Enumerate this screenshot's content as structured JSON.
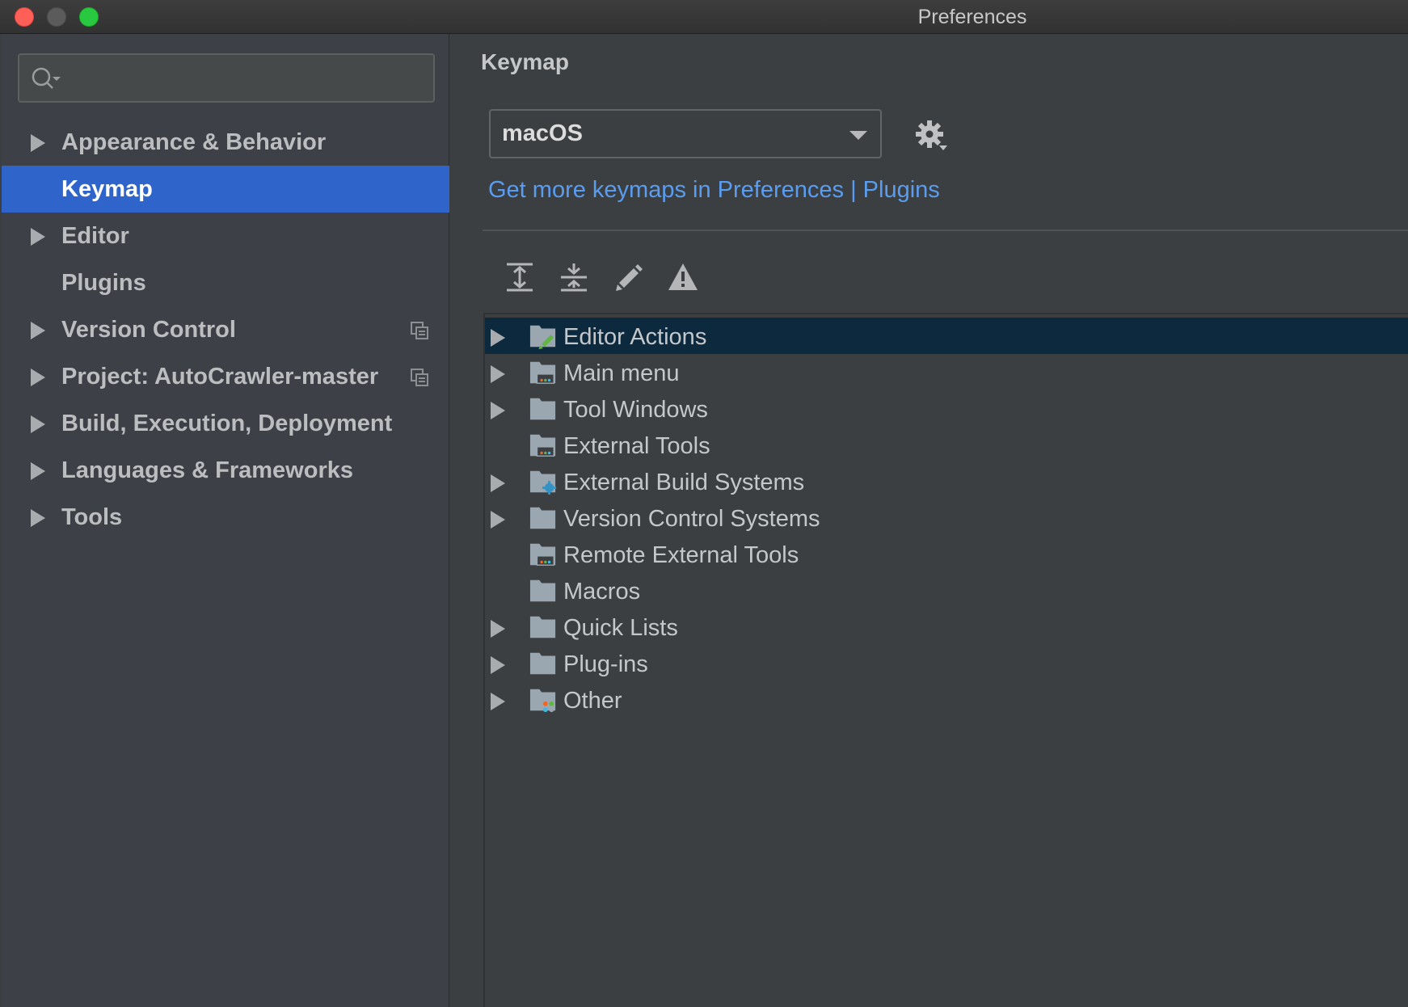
{
  "window": {
    "title": "Preferences",
    "controls": [
      "close-icon",
      "minimize-icon",
      "zoom-icon"
    ]
  },
  "sidebar": {
    "search": {
      "placeholder": "",
      "icon": "search-icon"
    },
    "items": [
      {
        "label": "Appearance & Behavior",
        "expandable": true,
        "selected": false,
        "project_icon": false
      },
      {
        "label": "Keymap",
        "expandable": false,
        "selected": true,
        "project_icon": false
      },
      {
        "label": "Editor",
        "expandable": true,
        "selected": false,
        "project_icon": false
      },
      {
        "label": "Plugins",
        "expandable": false,
        "selected": false,
        "project_icon": false
      },
      {
        "label": "Version Control",
        "expandable": true,
        "selected": false,
        "project_icon": true
      },
      {
        "label": "Project: AutoCrawler-master",
        "expandable": true,
        "selected": false,
        "project_icon": true
      },
      {
        "label": "Build, Execution, Deployment",
        "expandable": true,
        "selected": false,
        "project_icon": false
      },
      {
        "label": "Languages & Frameworks",
        "expandable": true,
        "selected": false,
        "project_icon": false
      },
      {
        "label": "Tools",
        "expandable": true,
        "selected": false,
        "project_icon": false
      }
    ]
  },
  "main": {
    "title": "Keymap",
    "keymap_select": {
      "value": "macOS"
    },
    "settings_icon": "gear-icon",
    "link": "Get more keymaps in Preferences | Plugins",
    "toolbar": [
      "expand-all-icon",
      "collapse-all-icon",
      "edit-icon",
      "warning-icon"
    ],
    "tree": [
      {
        "label": "Editor Actions",
        "expandable": true,
        "selected": true,
        "icon": "editor-actions-folder-icon"
      },
      {
        "label": "Main menu",
        "expandable": true,
        "selected": false,
        "icon": "menu-folder-icon"
      },
      {
        "label": "Tool Windows",
        "expandable": true,
        "selected": false,
        "icon": "folder-icon"
      },
      {
        "label": "External Tools",
        "expandable": false,
        "selected": false,
        "icon": "tools-folder-icon"
      },
      {
        "label": "External Build Systems",
        "expandable": true,
        "selected": false,
        "icon": "build-folder-icon"
      },
      {
        "label": "Version Control Systems",
        "expandable": true,
        "selected": false,
        "icon": "folder-icon"
      },
      {
        "label": "Remote External Tools",
        "expandable": false,
        "selected": false,
        "icon": "tools-folder-icon"
      },
      {
        "label": "Macros",
        "expandable": false,
        "selected": false,
        "icon": "folder-icon"
      },
      {
        "label": "Quick Lists",
        "expandable": true,
        "selected": false,
        "icon": "folder-icon"
      },
      {
        "label": "Plug-ins",
        "expandable": true,
        "selected": false,
        "icon": "folder-icon"
      },
      {
        "label": "Other",
        "expandable": true,
        "selected": false,
        "icon": "other-folder-icon"
      }
    ]
  },
  "colors": {
    "selection_sidebar": "#2f65ca",
    "selection_tree": "#0d293e",
    "link": "#5a9df0"
  }
}
